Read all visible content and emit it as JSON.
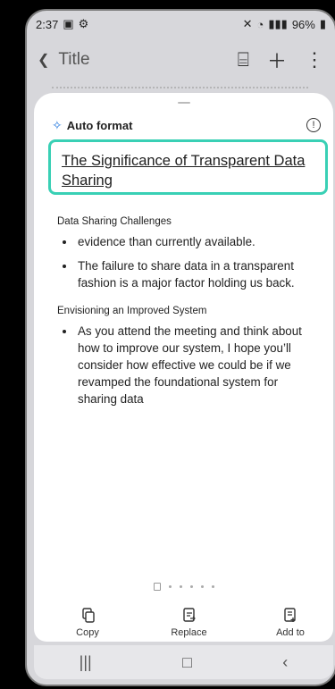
{
  "status": {
    "time": "2:37",
    "battery": "96%"
  },
  "app": {
    "title": "Title"
  },
  "sheet": {
    "title": "Auto format",
    "headline": "The Significance of Transparent Data Sharing",
    "sections": [
      {
        "heading": "Data Sharing Challenges",
        "items": [
          "evidence than currently available.",
          "The failure to share data in a transparent fashion is a major factor holding us back."
        ]
      },
      {
        "heading": "Envisioning an Improved System",
        "items": [
          "As you attend the meeting and think about how to improve our system, I hope you’ll consider how effective we could be if we revamped the foundational system for sharing data"
        ]
      }
    ]
  },
  "actions": {
    "copy": "Copy",
    "replace": "Replace",
    "add_to": "Add to"
  }
}
